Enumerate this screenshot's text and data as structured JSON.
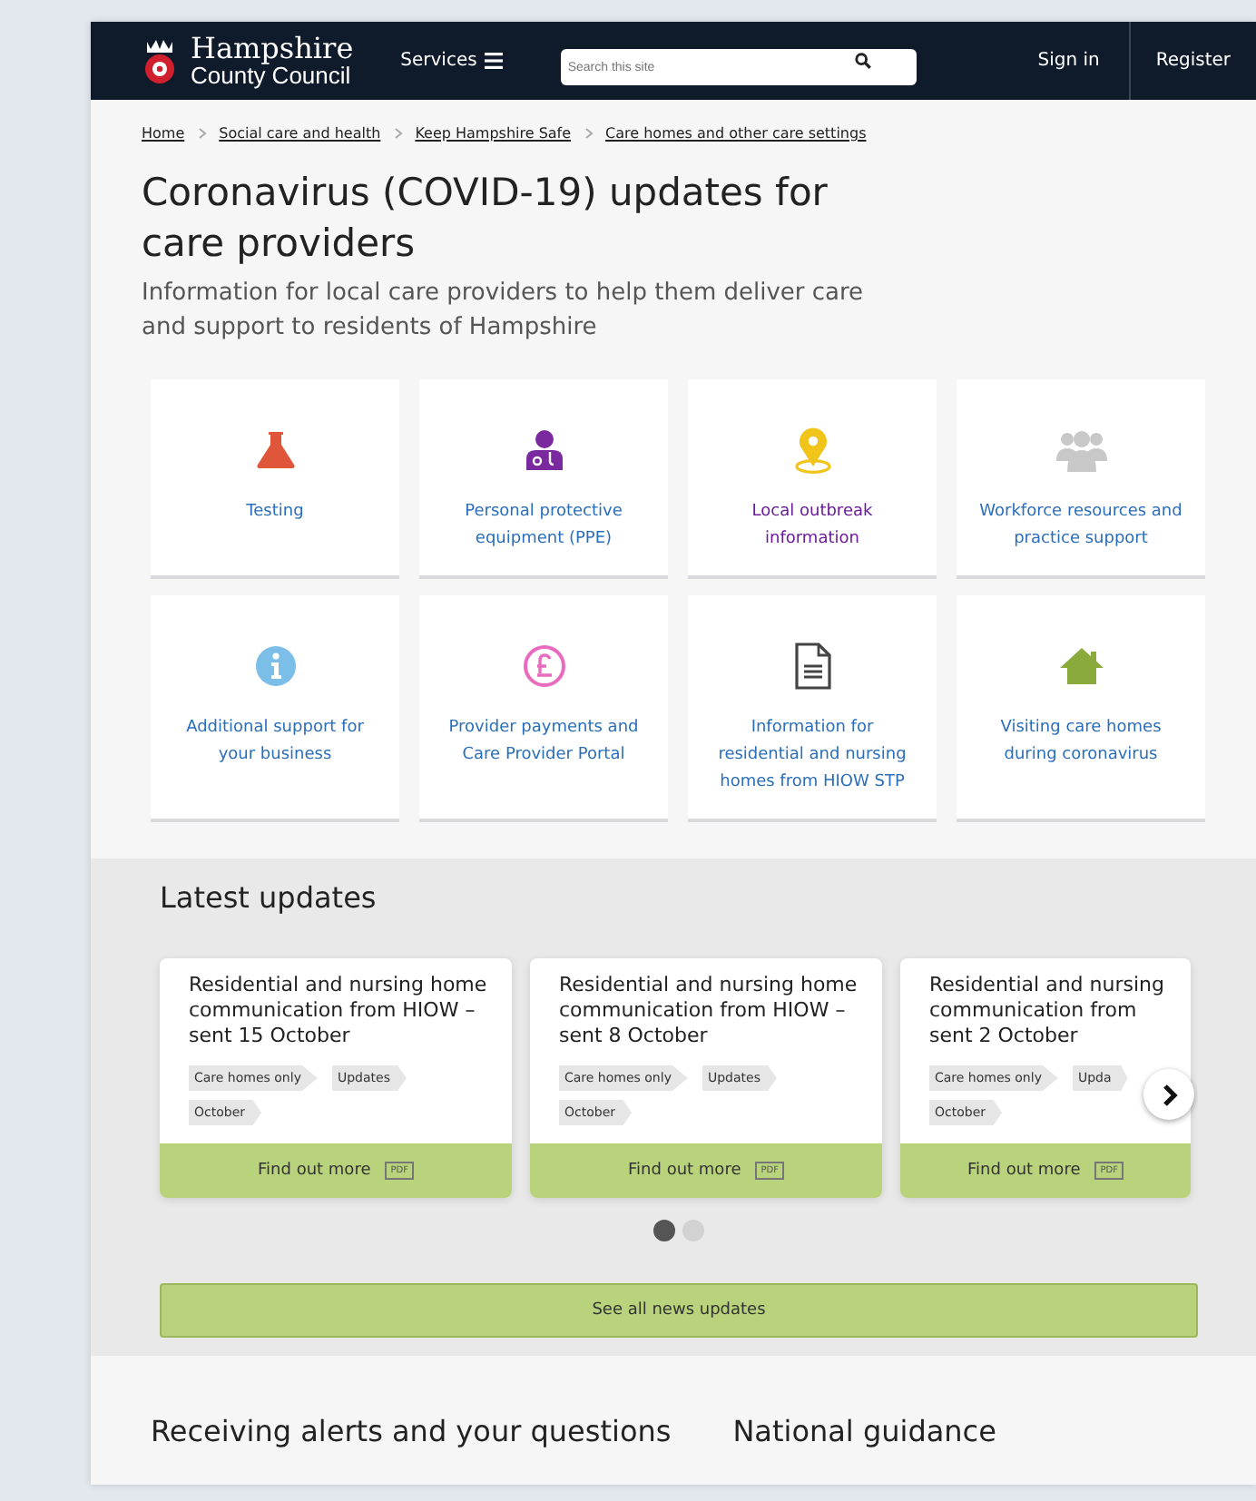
{
  "header": {
    "logo_line_1": "Hampshire",
    "logo_line_2": "County Council",
    "services": "Services",
    "search": {
      "placeholder": "Search this site"
    },
    "sign_in": "Sign in",
    "register": "Register"
  },
  "breadcrumbs": [
    "Home",
    "Social care and health",
    "Keep Hampshire Safe",
    "Care homes and other care settings"
  ],
  "title": "Coronavirus (COVID-19) updates for care providers",
  "subtitle": "Information for local care providers to help them deliver care and support to residents of Hampshire",
  "tiles": [
    {
      "kind": "flask",
      "label": "Testing",
      "visited": false
    },
    {
      "kind": "doctor",
      "label": "Personal protective equipment (PPE)",
      "visited": false
    },
    {
      "kind": "pin",
      "label": "Local outbreak information",
      "visited": true
    },
    {
      "kind": "people",
      "label": "Workforce resources and practice support",
      "visited": false
    },
    {
      "kind": "info",
      "label": "Additional support for your business",
      "visited": false
    },
    {
      "kind": "pound",
      "label": "Provider payments and Care Provider Portal",
      "visited": false
    },
    {
      "kind": "document",
      "label": "Information for residential and nursing homes from HIOW STP",
      "visited": false
    },
    {
      "kind": "house",
      "label": "Visiting care homes during coronavirus",
      "visited": false
    }
  ],
  "latest_updates": {
    "heading": "Latest updates",
    "cards": [
      {
        "title_lines": [
          "Residential and nursing home",
          "communication from HIOW –",
          "sent 15 October"
        ],
        "tags": [
          "Care homes only",
          "Updates",
          "October"
        ],
        "link": "Find out more",
        "file_type": "PDF"
      },
      {
        "title_lines": [
          "Residential and nursing home",
          "communication from HIOW –",
          "sent 8 October"
        ],
        "tags": [
          "Care homes only",
          "Updates",
          "October"
        ],
        "link": "Find out more",
        "file_type": "PDF"
      },
      {
        "title_lines": [
          "Residential and nursing",
          "communication from",
          "sent 2 October"
        ],
        "tags": [
          "Care homes only",
          "Upda",
          "October"
        ],
        "link": "Find out more",
        "file_type": "PDF"
      }
    ],
    "dots": [
      {
        "selected": true
      },
      {
        "selected": false
      }
    ],
    "see_all": "See all news updates"
  },
  "bottom_headings": [
    "Receiving alerts and your questions",
    "National guidance"
  ]
}
